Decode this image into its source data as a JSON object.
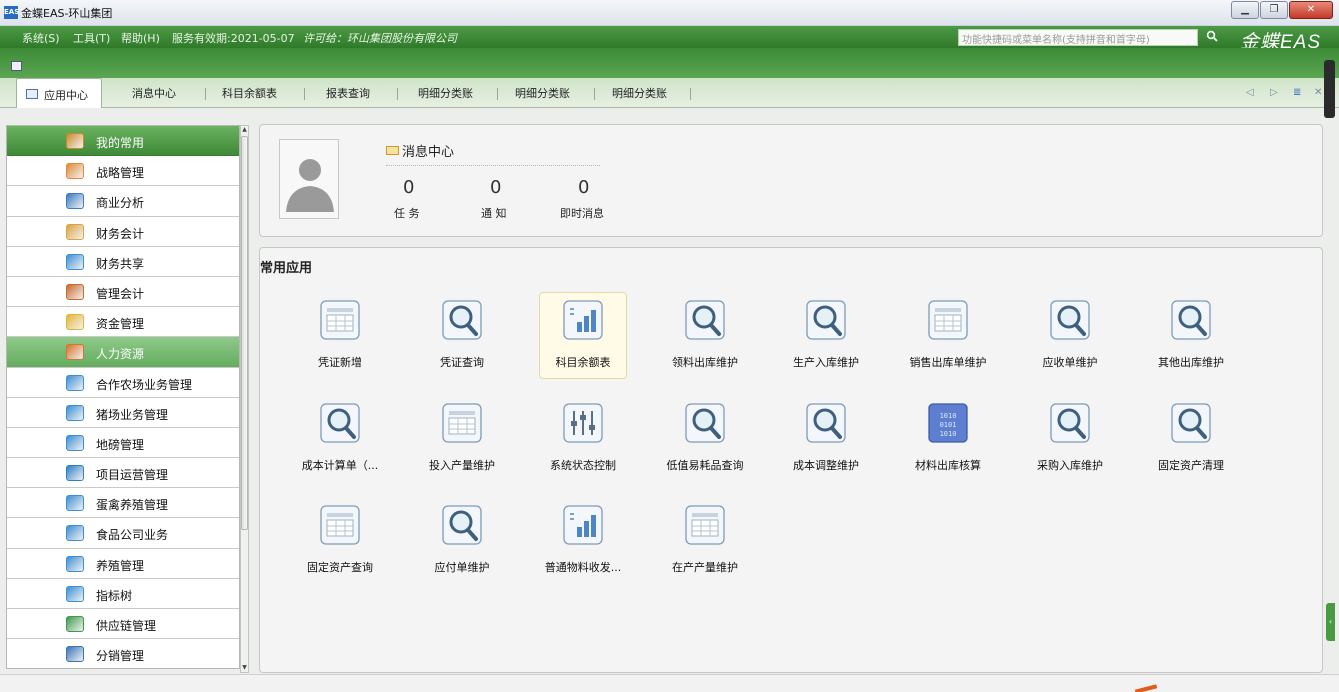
{
  "window": {
    "title": "金蝶EAS-环山集团",
    "icon": "EAS"
  },
  "menubar": {
    "items": [
      {
        "label": "系统(S)"
      },
      {
        "label": "工具(T)"
      },
      {
        "label": "帮助(H)"
      }
    ],
    "service_period": "服务有效期:2021-05-07",
    "license": "许可给：环山集团股份有限公司",
    "search_placeholder": "功能快捷码或菜单名称(支持拼音和首字母)",
    "brand": "金蝶EAS"
  },
  "tabs": [
    {
      "label": "应用中心",
      "active": true
    },
    {
      "label": "消息中心"
    },
    {
      "label": "科目余额表"
    },
    {
      "label": "报表查询"
    },
    {
      "label": "明细分类账"
    },
    {
      "label": "明细分类账"
    },
    {
      "label": "明细分类账"
    }
  ],
  "sidebar": {
    "items": [
      {
        "label": "我的常用",
        "icon": "pen-icon",
        "color": "#c98b2a",
        "state": "green"
      },
      {
        "label": "战略管理",
        "icon": "user-chart-icon",
        "color": "#e08a3a"
      },
      {
        "label": "商业分析",
        "icon": "chart-icon",
        "color": "#3a7bc4"
      },
      {
        "label": "财务会计",
        "icon": "ledger-icon",
        "color": "#d9a441"
      },
      {
        "label": "财务共享",
        "icon": "books-icon",
        "color": "#3c8fd4"
      },
      {
        "label": "管理会计",
        "icon": "manager-icon",
        "color": "#c96a2e"
      },
      {
        "label": "资金管理",
        "icon": "coins-icon",
        "color": "#e2b53a"
      },
      {
        "label": "人力资源",
        "icon": "people-icon",
        "color": "#d6732c",
        "state": "hr"
      },
      {
        "label": "合作农场业务管理",
        "icon": "books-icon",
        "color": "#3c8fd4"
      },
      {
        "label": "猪场业务管理",
        "icon": "books-icon",
        "color": "#3c8fd4"
      },
      {
        "label": "地磅管理",
        "icon": "books-icon",
        "color": "#3c8fd4"
      },
      {
        "label": "项目运营管理",
        "icon": "project-icon",
        "color": "#2f7fc8"
      },
      {
        "label": "蛋禽养殖管理",
        "icon": "books-icon",
        "color": "#3c8fd4"
      },
      {
        "label": "食品公司业务",
        "icon": "books-icon",
        "color": "#3c8fd4"
      },
      {
        "label": "养殖管理",
        "icon": "books-icon",
        "color": "#3c8fd4"
      },
      {
        "label": "指标树",
        "icon": "books-icon",
        "color": "#3c8fd4"
      },
      {
        "label": "供应链管理",
        "icon": "globe-icon",
        "color": "#3f9a4c"
      },
      {
        "label": "分销管理",
        "icon": "truck-icon",
        "color": "#3a73b8"
      }
    ]
  },
  "messages": {
    "title": "消息中心",
    "counters": [
      {
        "value": "0",
        "label": "任 务"
      },
      {
        "value": "0",
        "label": "通 知"
      },
      {
        "value": "0",
        "label": "即时消息"
      }
    ]
  },
  "apps": {
    "title": "常用应用",
    "items": [
      {
        "label": "凭证新增",
        "icon": "form-icon"
      },
      {
        "label": "凭证查询",
        "icon": "magnifier-icon"
      },
      {
        "label": "科目余额表",
        "icon": "bar-chart-icon",
        "selected": true
      },
      {
        "label": "领料出库维护",
        "icon": "magnifier-icon"
      },
      {
        "label": "生产入库维护",
        "icon": "magnifier-icon"
      },
      {
        "label": "销售出库单维护",
        "icon": "form-icon"
      },
      {
        "label": "应收单维护",
        "icon": "magnifier-icon"
      },
      {
        "label": "其他出库维护",
        "icon": "magnifier-icon"
      },
      {
        "label": "成本计算单（...",
        "icon": "magnifier-icon"
      },
      {
        "label": "投入产量维护",
        "icon": "form-icon"
      },
      {
        "label": "系统状态控制",
        "icon": "sliders-icon"
      },
      {
        "label": "低值易耗品查询",
        "icon": "magnifier-icon"
      },
      {
        "label": "成本调整维护",
        "icon": "magnifier-icon"
      },
      {
        "label": "材料出库核算",
        "icon": "binary-icon"
      },
      {
        "label": "采购入库维护",
        "icon": "magnifier-icon"
      },
      {
        "label": "固定资产清理",
        "icon": "magnifier-icon"
      },
      {
        "label": "固定资产查询",
        "icon": "form-icon"
      },
      {
        "label": "应付单维护",
        "icon": "magnifier-icon"
      },
      {
        "label": "普通物料收发...",
        "icon": "bar-chart-icon"
      },
      {
        "label": "在产产量维护",
        "icon": "form-icon"
      }
    ]
  }
}
